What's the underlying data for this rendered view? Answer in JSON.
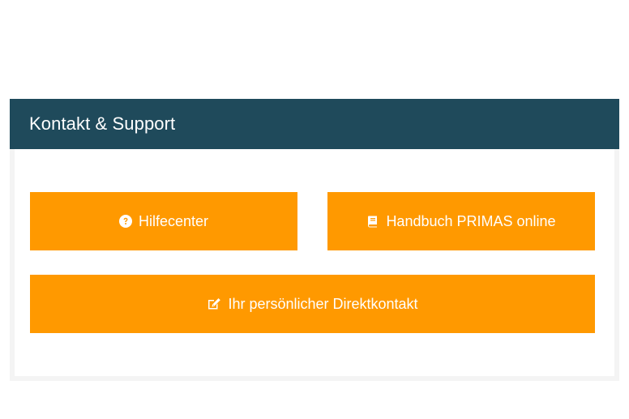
{
  "panel": {
    "title": "Kontakt & Support"
  },
  "buttons": {
    "help": {
      "label": "Hilfecenter",
      "icon": "question-circle-icon"
    },
    "manual": {
      "label": "Handbuch PRIMAS online",
      "icon": "book-icon"
    },
    "contact": {
      "label": "Ihr persönlicher Direktkontakt",
      "icon": "edit-icon"
    }
  },
  "colors": {
    "header_bg": "#1f4a5b",
    "button_bg": "#ff9900",
    "text_on_accent": "#ffffff"
  }
}
